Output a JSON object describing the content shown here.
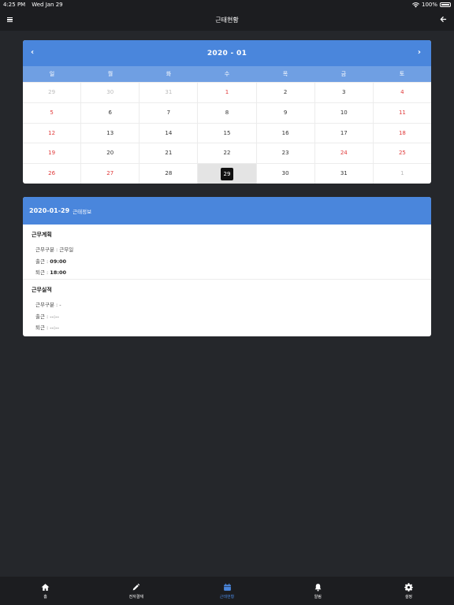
{
  "status_bar": {
    "time": "4:25 PM",
    "date": "Wed Jan 29",
    "battery": "100%"
  },
  "nav": {
    "title": "근태현황"
  },
  "calendar": {
    "month_label": "2020 - 01",
    "weekdays": [
      "일",
      "월",
      "화",
      "수",
      "목",
      "금",
      "토"
    ],
    "weeks": [
      [
        "29",
        "30",
        "31",
        "1",
        "2",
        "3",
        "4"
      ],
      [
        "5",
        "6",
        "7",
        "8",
        "9",
        "10",
        "11"
      ],
      [
        "12",
        "13",
        "14",
        "15",
        "16",
        "17",
        "18"
      ],
      [
        "19",
        "20",
        "21",
        "22",
        "23",
        "24",
        "25"
      ],
      [
        "26",
        "27",
        "28",
        "29",
        "30",
        "31",
        "1"
      ]
    ],
    "selected": "29"
  },
  "info": {
    "date": "2020-01-29",
    "subtitle": "근태정보",
    "plan": {
      "title": "근무계획",
      "type_label": "근무구분 : ",
      "type_value": "근무일",
      "in_label": "출근 : ",
      "in_value": "09:00",
      "out_label": "퇴근 : ",
      "out_value": "18:00"
    },
    "actual": {
      "title": "근무실적",
      "type_label": "근무구분 : ",
      "type_value": "-",
      "in_label": "출근 : ",
      "in_value": "--:--",
      "out_label": "퇴근 : ",
      "out_value": "--:--"
    }
  },
  "tabs": [
    {
      "label": "홈",
      "icon": "home-icon"
    },
    {
      "label": "전자결재",
      "icon": "pencil-icon"
    },
    {
      "label": "근태현황",
      "icon": "calendar-icon"
    },
    {
      "label": "알림",
      "icon": "bell-icon"
    },
    {
      "label": "설정",
      "icon": "gear-icon"
    }
  ],
  "colors": {
    "accent": "#4a86dc",
    "weekday_bar": "#6f9fe3",
    "holiday": "#e03a3a",
    "background": "#25272b"
  }
}
